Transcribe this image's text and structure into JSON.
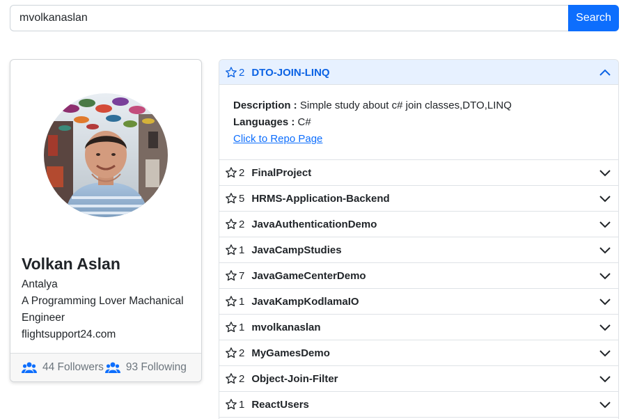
{
  "search": {
    "value": "mvolkanaslan",
    "placeholder": "",
    "button_label": "Search"
  },
  "profile": {
    "name": "Volkan Aslan",
    "location": "Antalya",
    "bio": "A Programming Lover Machanical Engineer",
    "website": "flightsupport24.com",
    "followers_label": "44 Followers",
    "following_label": "93 Following"
  },
  "repos": [
    {
      "stars": "2",
      "name": "DTO-JOIN-LINQ",
      "expanded": true,
      "description_label": "Description :",
      "description": "Simple study about c# join classes,DTO,LINQ",
      "languages_label": "Languages :",
      "languages": "C#",
      "link_label": "Click to Repo Page"
    },
    {
      "stars": "2",
      "name": "FinalProject"
    },
    {
      "stars": "5",
      "name": "HRMS-Application-Backend"
    },
    {
      "stars": "2",
      "name": "JavaAuthenticationDemo"
    },
    {
      "stars": "1",
      "name": "JavaCampStudies"
    },
    {
      "stars": "7",
      "name": "JavaGameCenterDemo"
    },
    {
      "stars": "1",
      "name": "JavaKampKodlamaIO"
    },
    {
      "stars": "1",
      "name": "mvolkanaslan"
    },
    {
      "stars": "2",
      "name": "MyGamesDemo"
    },
    {
      "stars": "2",
      "name": "Object-Join-Filter"
    },
    {
      "stars": "1",
      "name": "ReactUsers"
    }
  ],
  "icons": {
    "star": "star-outline-icon",
    "chevron_up": "chevron-up-icon",
    "chevron_down": "chevron-down-icon",
    "people": "people-icon"
  },
  "colors": {
    "primary": "#0d6efd",
    "accordion_active_bg": "#e7f1ff",
    "accordion_active_text": "#0c63e4"
  }
}
